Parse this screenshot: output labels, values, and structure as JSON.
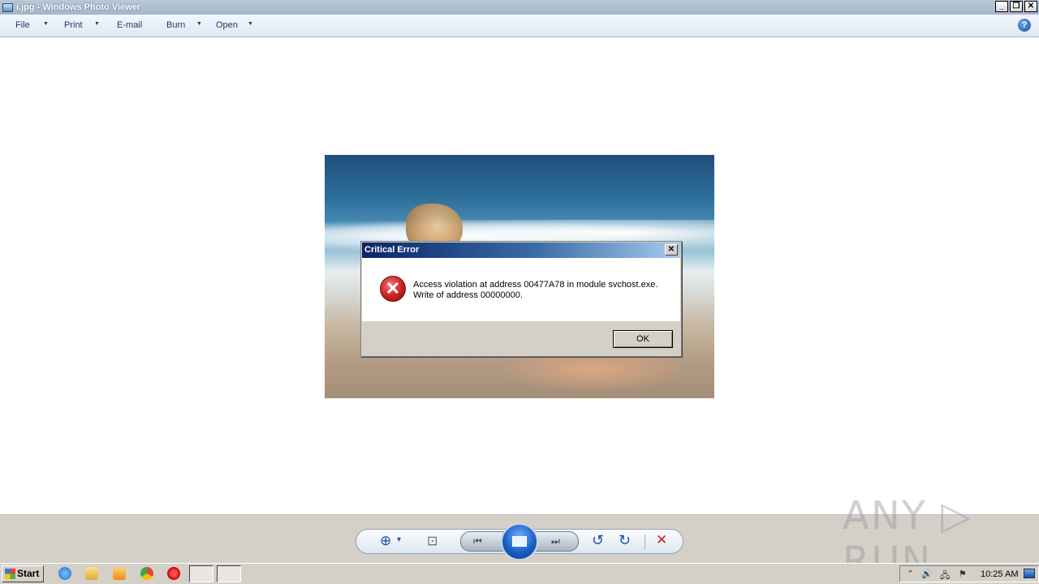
{
  "window": {
    "title": "i.jpg - Windows Photo Viewer",
    "controls": {
      "minimize": "_",
      "restore": "❐",
      "close": "✕"
    }
  },
  "menubar": {
    "items": [
      {
        "label": "File",
        "dropdown": true
      },
      {
        "label": "Print",
        "dropdown": true
      },
      {
        "label": "E-mail",
        "dropdown": false
      },
      {
        "label": "Burn",
        "dropdown": true
      },
      {
        "label": "Open",
        "dropdown": true
      }
    ],
    "help_icon": "?"
  },
  "dialog": {
    "title": "Critical Error",
    "close": "✕",
    "message_line1": "Access violation at address 00477A78 in module svchost.exe.",
    "message_line2": "Write of address 00000000.",
    "icon": "error-x-icon",
    "ok_label": "OK"
  },
  "controls": {
    "zoom": "⊕",
    "zoom_arrow": "▾",
    "actual_size": "⊡",
    "previous": "⏮",
    "next": "⏭",
    "rotate_ccw": "↺",
    "rotate_cw": "↻",
    "delete": "✕"
  },
  "watermark": "ANY ▷ RUN",
  "taskbar": {
    "start_label": "Start",
    "clock": "10:25 AM",
    "tray": {
      "expand": "⌃",
      "volume": "🔊",
      "network": "🖧",
      "flag": "⚑"
    }
  },
  "colors": {
    "titlebar": "#a3b6c9",
    "menubar": "#dde8f5",
    "dialog_title_start": "#0a246a",
    "dialog_title_end": "#a6caf0",
    "error_red": "#c81e1e",
    "control_blue": "#1b4f9e",
    "delete_red": "#cc1f1f"
  }
}
